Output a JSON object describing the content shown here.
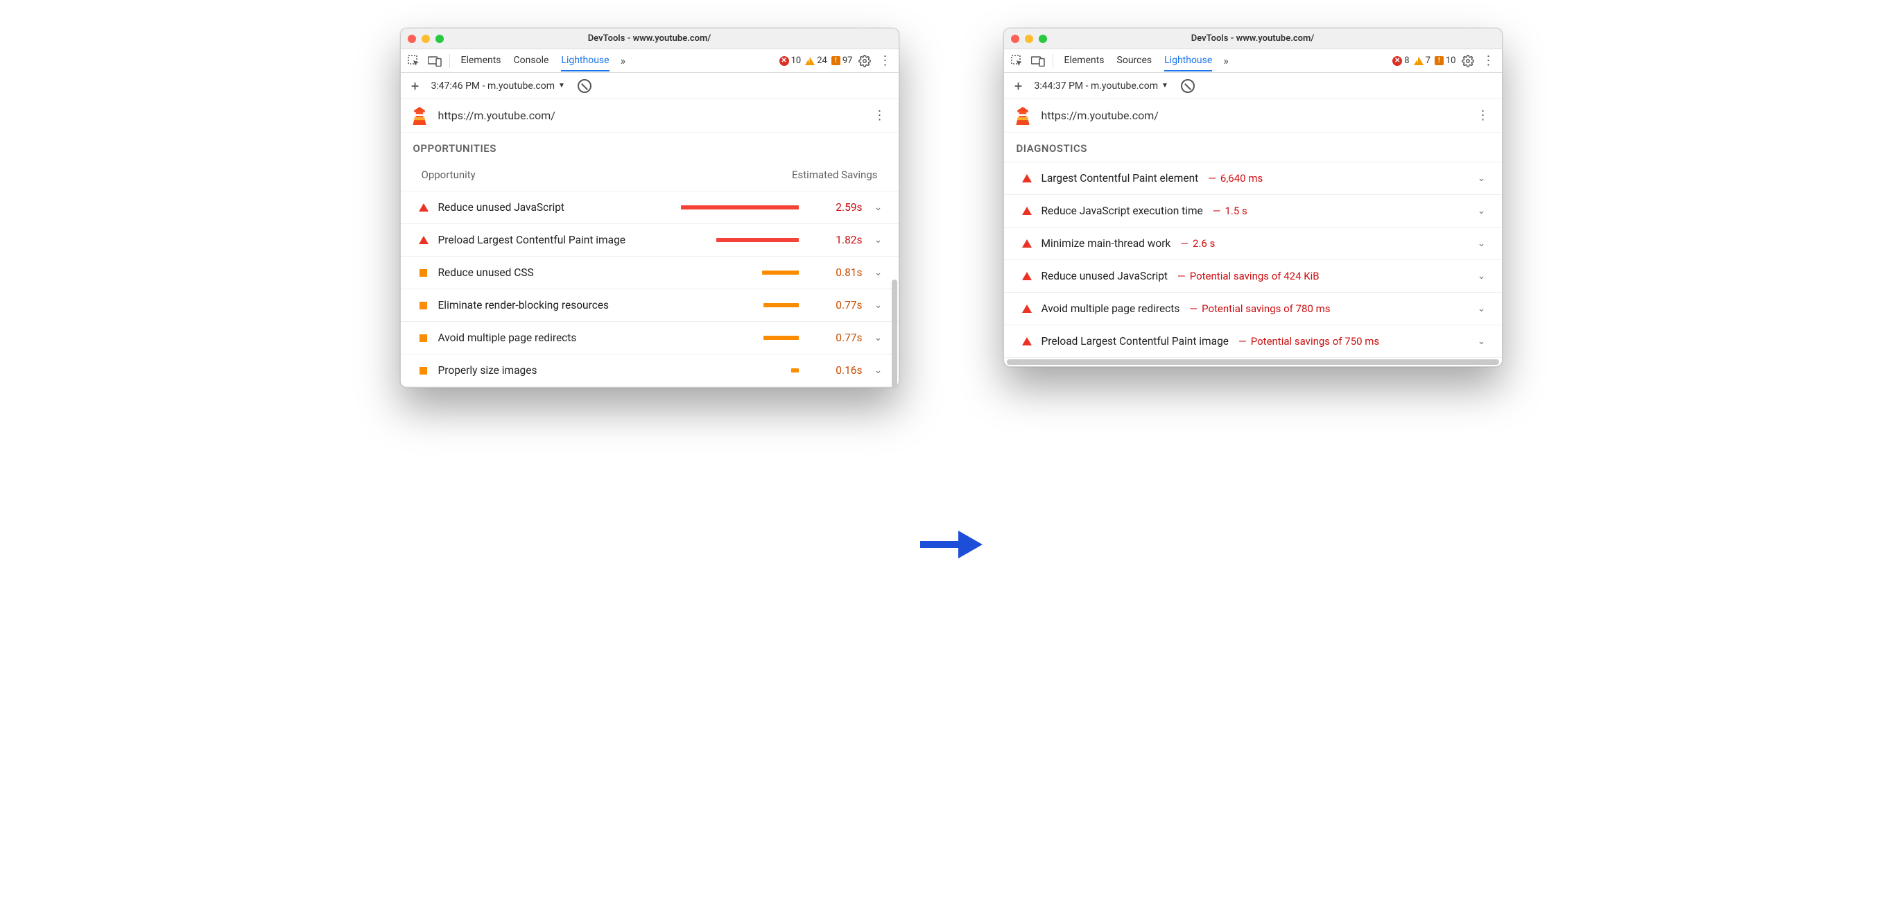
{
  "left": {
    "title": "DevTools - www.youtube.com/",
    "tabs": [
      "Elements",
      "Console",
      "Lighthouse"
    ],
    "activeTab": 2,
    "errCount": "10",
    "warnCount": "24",
    "infoCount": "97",
    "runLabel": "3:47:46 PM - m.youtube.com",
    "url": "https://m.youtube.com/",
    "section": "Opportunities",
    "colA": "Opportunity",
    "colB": "Estimated Savings",
    "audits": [
      {
        "sev": "red",
        "label": "Reduce unused JavaScript",
        "barPct": 100,
        "barColor": "red",
        "val": "2.59s",
        "valColor": "red"
      },
      {
        "sev": "red",
        "label": "Preload Largest Contentful Paint image",
        "barPct": 70,
        "barColor": "red",
        "val": "1.82s",
        "valColor": "red"
      },
      {
        "sev": "org",
        "label": "Reduce unused CSS",
        "barPct": 31,
        "barColor": "org",
        "val": "0.81s",
        "valColor": "org"
      },
      {
        "sev": "org",
        "label": "Eliminate render-blocking resources",
        "barPct": 30,
        "barColor": "org",
        "val": "0.77s",
        "valColor": "org"
      },
      {
        "sev": "org",
        "label": "Avoid multiple page redirects",
        "barPct": 30,
        "barColor": "org",
        "val": "0.77s",
        "valColor": "org"
      },
      {
        "sev": "org",
        "label": "Properly size images",
        "barPct": 6,
        "barColor": "org",
        "val": "0.16s",
        "valColor": "org"
      }
    ]
  },
  "right": {
    "title": "DevTools - www.youtube.com/",
    "tabs": [
      "Elements",
      "Sources",
      "Lighthouse"
    ],
    "activeTab": 2,
    "errCount": "8",
    "warnCount": "7",
    "infoCount": "10",
    "runLabel": "3:44:37 PM - m.youtube.com",
    "url": "https://m.youtube.com/",
    "section": "Diagnostics",
    "audits": [
      {
        "sev": "red",
        "label": "Largest Contentful Paint element",
        "metric": "6,640 ms"
      },
      {
        "sev": "red",
        "label": "Reduce JavaScript execution time",
        "metric": "1.5 s"
      },
      {
        "sev": "red",
        "label": "Minimize main-thread work",
        "metric": "2.6 s"
      },
      {
        "sev": "red",
        "label": "Reduce unused JavaScript",
        "metric": "Potential savings of 424 KiB"
      },
      {
        "sev": "red",
        "label": "Avoid multiple page redirects",
        "metric": "Potential savings of 780 ms"
      },
      {
        "sev": "red",
        "label": "Preload Largest Contentful Paint image",
        "metric": "Potential savings of 750 ms"
      }
    ]
  }
}
